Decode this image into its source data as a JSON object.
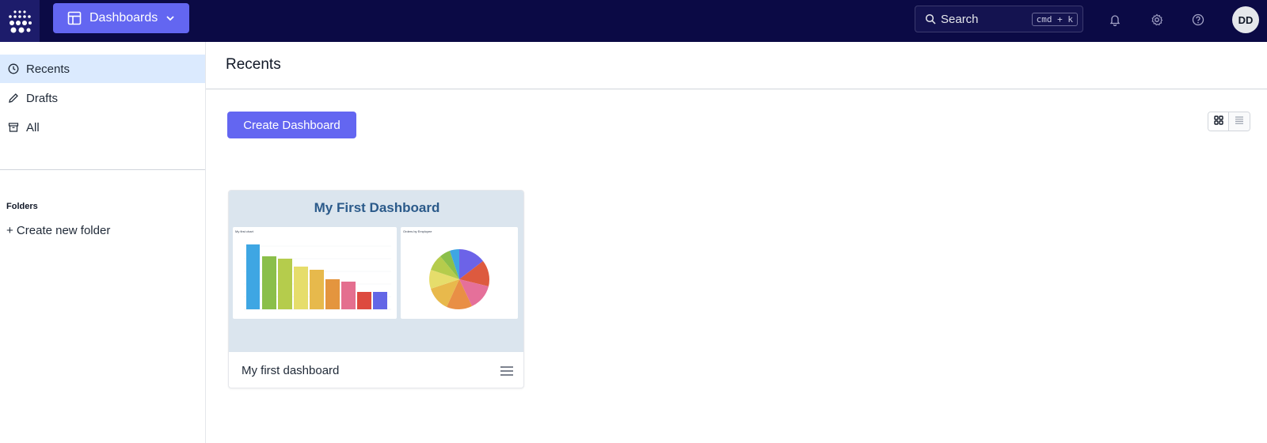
{
  "topbar": {
    "nav_button_label": "Dashboards",
    "search_label": "Search",
    "search_shortcut": "cmd + k",
    "avatar_initials": "DD",
    "icons": [
      "logo-icon",
      "dashboard-icon",
      "chevron-down-icon",
      "search-icon",
      "bell-icon",
      "gear-icon",
      "help-icon"
    ]
  },
  "sidebar": {
    "items": [
      {
        "label": "Recents",
        "icon": "clock-icon",
        "active": true
      },
      {
        "label": "Drafts",
        "icon": "pencil-icon",
        "active": false
      },
      {
        "label": "All",
        "icon": "archive-icon",
        "active": false
      }
    ],
    "folders_heading": "Folders",
    "create_folder_label": "+ Create new folder"
  },
  "main": {
    "title": "Recents",
    "create_button_label": "Create Dashboard",
    "view_modes": [
      "grid",
      "list"
    ],
    "selected_view": "grid",
    "cards": [
      {
        "name": "My first dashboard",
        "thumbnail_title": "My First Dashboard",
        "bar_panel_title": "My first chart",
        "pie_panel_title": "Orders by Employee"
      }
    ]
  },
  "colors": {
    "topbar_bg": "#0b0a45",
    "accent": "#6366f1",
    "active_item_bg": "#dbeafe",
    "thumbnail_bg": "#dbe5ee"
  }
}
